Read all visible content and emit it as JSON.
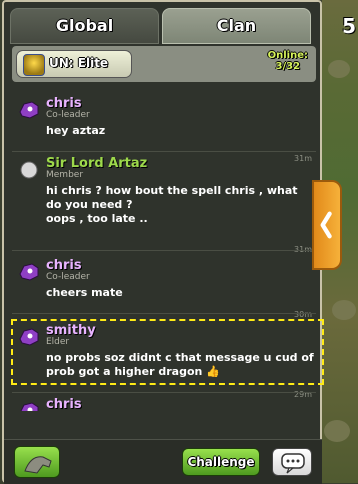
{
  "tabs": {
    "global": "Global",
    "clan": "Clan"
  },
  "clan": {
    "name": "UN: Elite",
    "online_label": "Online:",
    "online_value": "3/32"
  },
  "messages": [
    {
      "name": "chris",
      "role": "Co-leader",
      "text": "hey aztaz",
      "time": "31m"
    },
    {
      "name": "Sir Lord Artaz",
      "role": "Member",
      "text": "hi chris ? how bout the spell chris , what do you need ?\noops , too late ..",
      "time": "31m"
    },
    {
      "name": "chris",
      "role": "Co-leader",
      "text": "cheers mate",
      "time": "30m"
    },
    {
      "name": "smithy",
      "role": "Elder",
      "text": "no probs soz didnt c that message u cud of prob got a higher dragon 👍",
      "time": "29m"
    },
    {
      "name": "chris",
      "role": "Co-leader",
      "text": "",
      "time": ""
    }
  ],
  "bottom": {
    "challenge_label": "Challenge"
  },
  "background": {
    "counter": "5"
  },
  "colors": {
    "name_purple": "#e8b3ff",
    "name_green": "#9dd94b",
    "online": "#d7f35b",
    "highlight": "#ffeb16"
  },
  "icons": {
    "side_tab": "chevron-left-icon",
    "left_button": "statue-icon",
    "right_button": "chat-bubble-icon"
  }
}
